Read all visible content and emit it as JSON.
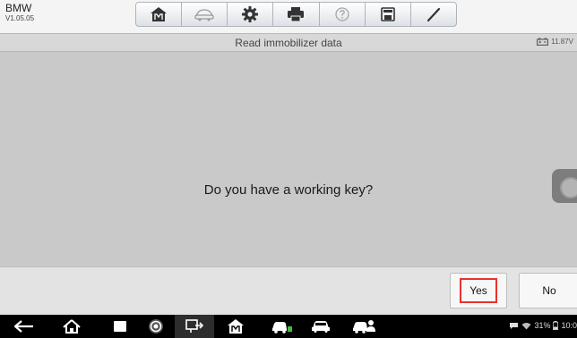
{
  "header": {
    "brand": "BMW",
    "version": "V1.05.05",
    "toolbar": [
      {
        "icon": "home-icon"
      },
      {
        "icon": "vehicle-swap-icon"
      },
      {
        "icon": "settings-gear-icon"
      },
      {
        "icon": "print-icon"
      },
      {
        "icon": "help-icon"
      },
      {
        "icon": "save-icon"
      },
      {
        "icon": "edit-icon"
      }
    ]
  },
  "titlebar": {
    "title": "Read immobilizer data",
    "voltage": "11.87V"
  },
  "dialog": {
    "question": "Do you have a working key?"
  },
  "actions": {
    "yes_label": "Yes",
    "no_label": "No",
    "highlight_color": "#e8322e"
  },
  "system_bar": {
    "battery_percent": "31%",
    "time": "10:0"
  }
}
